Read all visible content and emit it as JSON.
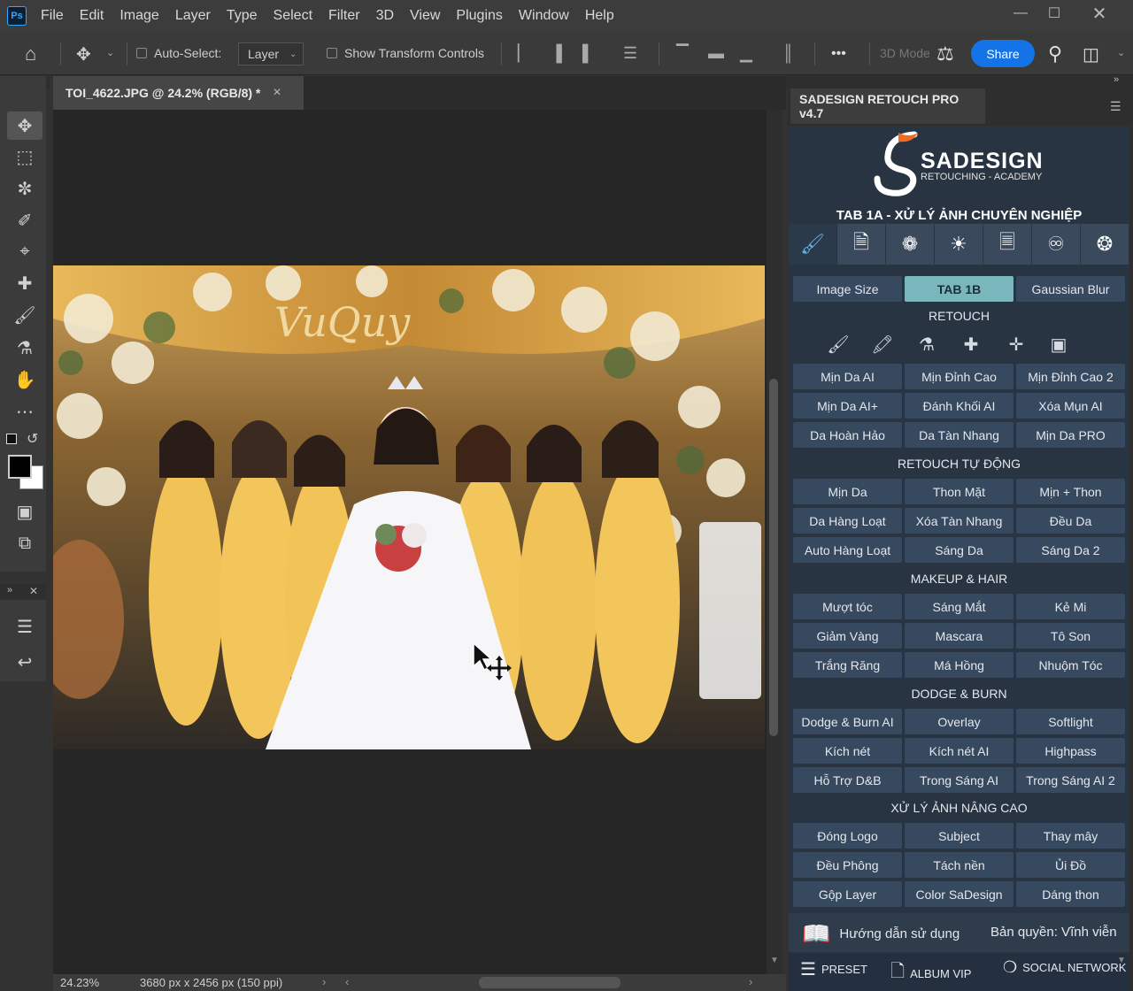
{
  "app": {
    "logo": "Ps"
  },
  "menu": [
    "File",
    "Edit",
    "Image",
    "Layer",
    "Type",
    "Select",
    "Filter",
    "3D",
    "View",
    "Plugins",
    "Window",
    "Help"
  ],
  "options": {
    "auto_select": "Auto-Select:",
    "layer_dropdown": "Layer",
    "show_transform": "Show Transform Controls",
    "more": "•••",
    "mode3d": "3D Mode",
    "share": "Share"
  },
  "document": {
    "tab_title": "TOI_4622.JPG @ 24.2% (RGB/8) *",
    "close": "×",
    "zoom": "24.23%",
    "dimensions": "3680 px x 2456 px (150 ppi)"
  },
  "panel": {
    "title": "SADESIGN RETOUCH PRO v4.7",
    "brand": "SADESIGN",
    "brand_sub": "RETOUCHING - ACADEMY",
    "tab_heading": "TAB 1A - XỬ LÝ ẢNH CHUYÊN NGHIỆP",
    "top_buttons": [
      "Image Size",
      "TAB 1B",
      "Gaussian Blur"
    ],
    "sections": [
      {
        "title": "RETOUCH",
        "buttons": [
          "Mịn Da AI",
          "Mịn Đỉnh Cao",
          "Mịn Đỉnh Cao 2",
          "Mịn Da AI+",
          "Đánh Khối AI",
          "Xóa Mụn AI",
          "Da Hoàn Hảo",
          "Da Tàn Nhang",
          "Mịn Da PRO"
        ]
      },
      {
        "title": "RETOUCH TỰ ĐỘNG",
        "buttons": [
          "Mịn Da",
          "Thon Mặt",
          "Mịn + Thon",
          "Da Hàng Loạt",
          "Xóa Tàn Nhang",
          "Đều Da",
          "Auto Hàng Loạt",
          "Sáng Da",
          "Sáng Da 2"
        ]
      },
      {
        "title": "MAKEUP & HAIR",
        "buttons": [
          "Mượt tóc",
          "Sáng Mắt",
          "Kẻ Mi",
          "Giảm Vàng",
          "Mascara",
          "Tô Son",
          "Trắng Răng",
          "Má Hồng",
          "Nhuộm Tóc"
        ]
      },
      {
        "title": "DODGE & BURN",
        "buttons": [
          "Dodge & Burn AI",
          "Overlay",
          "Softlight",
          "Kích nét",
          "Kích nét AI",
          "Highpass",
          "Hỗ Trợ D&B",
          "Trong Sáng AI",
          "Trong Sáng AI 2"
        ]
      },
      {
        "title": "XỬ LÝ ẢNH NÂNG CAO",
        "buttons": [
          "Đóng Logo",
          "Subject",
          "Thay mây",
          "Đều Phông",
          "Tách nền",
          "Ủi Đồ",
          "Gộp Layer",
          "Color SaDesign",
          "Dáng thon"
        ]
      }
    ],
    "guide": "Hướng dẫn sử dụng",
    "license": "Bản quyền: Vĩnh viễn",
    "preset": "PRESET",
    "album": "ALBUM VIP",
    "social": "SOCIAL NETWORK"
  },
  "photo": {
    "sign": "VuQuy"
  }
}
